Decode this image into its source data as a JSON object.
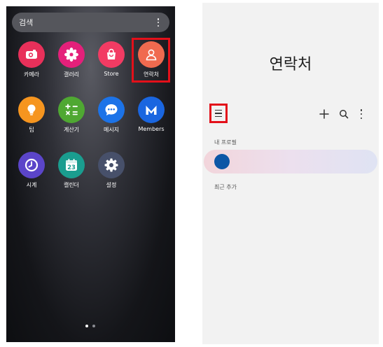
{
  "left_screen": {
    "search": {
      "placeholder": "검색"
    },
    "apps": [
      {
        "label": "카메라",
        "icon": "camera-icon",
        "color": "#e8305a"
      },
      {
        "label": "갤러리",
        "icon": "flower-icon",
        "color": "#e4207a"
      },
      {
        "label": "Store",
        "icon": "shopping-bag-icon",
        "color": "#f23b63"
      },
      {
        "label": "연락처",
        "icon": "person-icon",
        "color": "#f06a4f"
      },
      {
        "label": "팁",
        "icon": "lightbulb-icon",
        "color": "#f6951f"
      },
      {
        "label": "계산기",
        "icon": "calculator-icon",
        "color": "#4fa832"
      },
      {
        "label": "메시지",
        "icon": "chat-bubble-icon",
        "color": "#1c73e8"
      },
      {
        "label": "Members",
        "icon": "members-m-icon",
        "color": "#1a66e0"
      },
      {
        "label": "시계",
        "icon": "clock-icon",
        "color": "#5b45c9"
      },
      {
        "label": "캘린더",
        "icon": "calendar-icon",
        "color": "#1a9d8f",
        "badge": "23"
      },
      {
        "label": "설정",
        "icon": "gear-icon",
        "color": "#47506a"
      }
    ],
    "page_indicator": {
      "current": 1,
      "total": 2
    }
  },
  "right_screen": {
    "title": "연락처",
    "my_profile_label": "내 프로필",
    "recent_label": "최근 추가",
    "toolbar": {
      "menu_icon": "hamburger-icon",
      "add_icon": "plus-icon",
      "search_icon": "search-icon",
      "more_icon": "more-vertical-icon"
    }
  },
  "colors": {
    "highlight": "#e3101a",
    "profile_avatar": "#0d56a6"
  }
}
